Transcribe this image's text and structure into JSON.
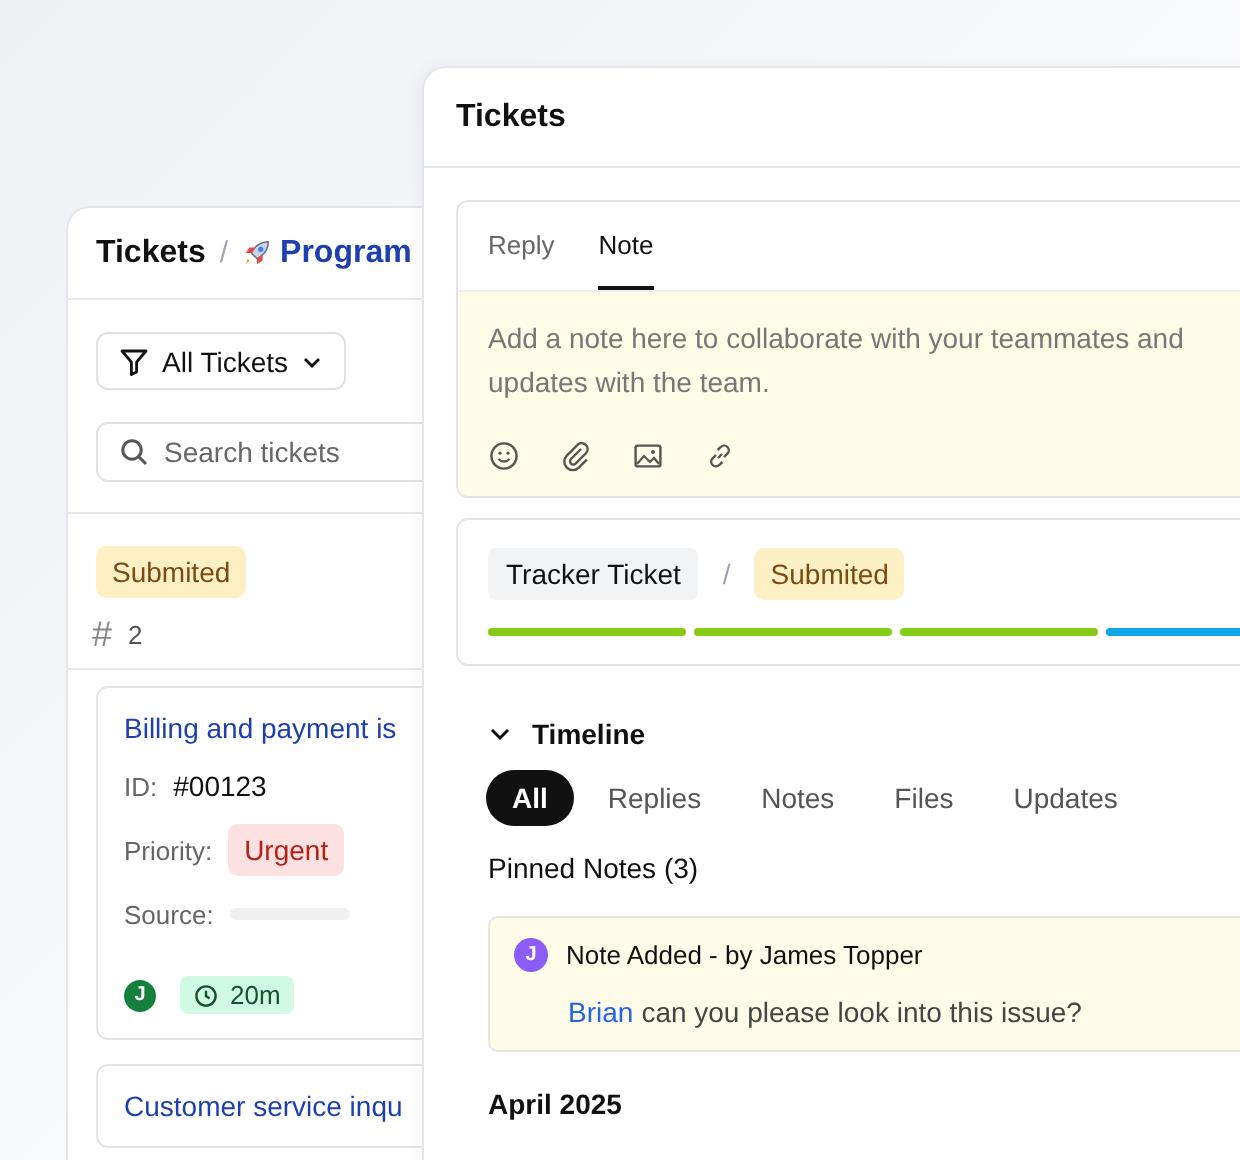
{
  "back_window": {
    "breadcrumb": {
      "title": "Tickets",
      "separator": "/",
      "project": "Program"
    },
    "filter": {
      "label": "All Tickets"
    },
    "search": {
      "placeholder": "Search tickets"
    },
    "group": {
      "status": "Submited",
      "count_mark": "#",
      "count": "2"
    },
    "cards": [
      {
        "title": "Billing and payment is",
        "fields": [
          {
            "kind": "text",
            "label": "ID:",
            "value": "#00123"
          },
          {
            "kind": "badge",
            "label": "Priority:",
            "value": "Urgent"
          },
          {
            "kind": "skeleton",
            "label": "Source:"
          }
        ],
        "assignee": "J",
        "age": "20m"
      },
      {
        "title": "Customer service inqu"
      }
    ]
  },
  "front_window": {
    "title": "Tickets",
    "composer": {
      "tabs": [
        {
          "label": "Reply",
          "selected": false
        },
        {
          "label": "Note",
          "selected": true
        }
      ],
      "placeholder": "Add a note here to collaborate with your teammates and\nupdates with the team."
    },
    "tracker": {
      "type": "Tracker Ticket",
      "separator": "/",
      "status": "Submited",
      "steps": [
        {
          "color": "#84cc16"
        },
        {
          "color": "#84cc16"
        },
        {
          "color": "#84cc16"
        },
        {
          "color": "#0ea5e9"
        }
      ]
    },
    "timeline": {
      "title": "Timeline",
      "expanded": true,
      "filters": [
        {
          "label": "All",
          "selected": true
        },
        {
          "label": "Replies",
          "selected": false
        },
        {
          "label": "Notes",
          "selected": false
        },
        {
          "label": "Files",
          "selected": false
        },
        {
          "label": "Updates",
          "selected": false
        }
      ],
      "pinned_label": "Pinned Notes (3)",
      "notes": [
        {
          "avatar": "J",
          "heading": "Note Added - by James Topper",
          "mention": "Brian",
          "text": "can you please look into this issue?"
        }
      ],
      "month": "April 2025"
    }
  }
}
